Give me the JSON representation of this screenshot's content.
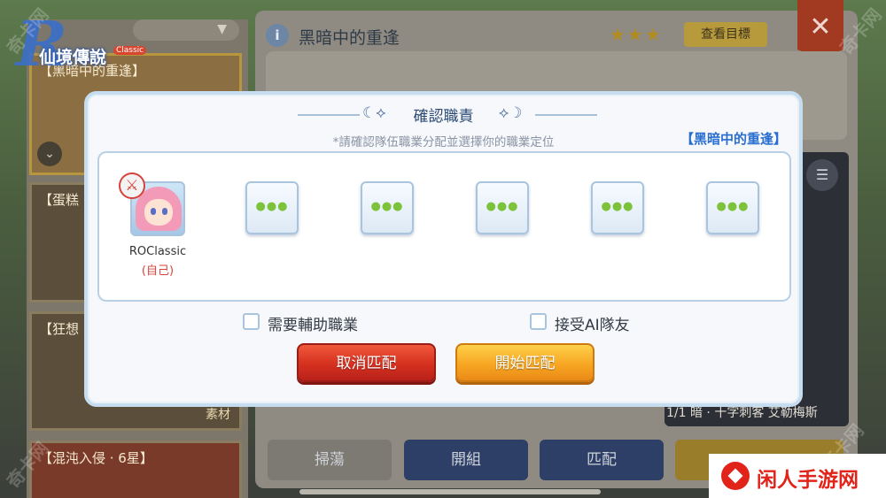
{
  "background": {
    "dropdown_icon": "chevron-down",
    "cards": [
      {
        "label": "【黑暗中的重逢】"
      },
      {
        "label": "【蛋糕"
      },
      {
        "label": "【狂想",
        "sub": "素材"
      },
      {
        "label": "【混沌入侵 · 6星】"
      }
    ],
    "header": {
      "title": "黑暗中的重逢",
      "goal_button": "查看目標"
    },
    "status": "1/1 暗 · 十字刺客 艾勒梅斯",
    "bottom_buttons": [
      "掃蕩",
      "開組",
      "匹配"
    ]
  },
  "logo": {
    "text": "仙境傳說",
    "badge": "Classic"
  },
  "modal": {
    "title": "確認職責",
    "hint": "*請確認隊伍職業分配並選擇你的職業定位",
    "quest": "【黑暗中的重逢】",
    "player": {
      "name": "ROClassic",
      "self": "(自己)"
    },
    "empty_slot_count": 5,
    "options": {
      "need_support": "需要輔助職業",
      "accept_ai": "接受AI隊友"
    },
    "buttons": {
      "cancel": "取消匹配",
      "start": "開始匹配"
    }
  },
  "watermark": "奇卡网",
  "brand": {
    "text": "闲人手游网"
  }
}
